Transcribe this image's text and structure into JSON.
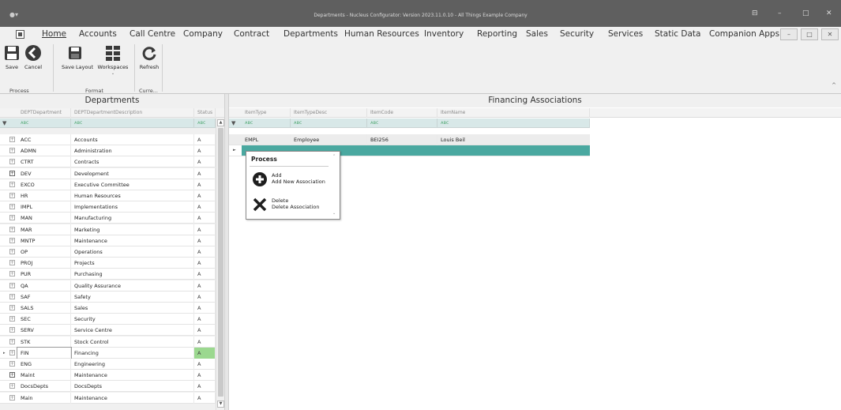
{
  "window": {
    "title": "Departments - Nucleus Configurator: Version 2023.11.0.10 - All Things Example Company",
    "app_icon": "app-icon",
    "controls": [
      "⊟",
      "–",
      "□",
      "✕"
    ]
  },
  "menu": {
    "items": [
      "Home",
      "Accounts",
      "Call Centre",
      "Company",
      "Contract",
      "Departments",
      "Human Resources",
      "Inventory",
      "Reporting",
      "Sales",
      "Security",
      "Services",
      "Static Data",
      "Companion Apps"
    ],
    "active": "Home",
    "mdi_controls": [
      "–",
      "□",
      "✕"
    ]
  },
  "ribbon": {
    "buttons": {
      "save": "Save",
      "cancel": "Cancel",
      "save_layout": "Save Layout",
      "workspaces": "Workspaces",
      "refresh": "Refresh"
    },
    "groups": {
      "process": "Process",
      "format": "Format",
      "current": "Curre..."
    },
    "collapse_glyph": "^"
  },
  "departments": {
    "title": "Departments",
    "columns": [
      "DEPTDepartment",
      "DEPTDepartmentDescription",
      "Status"
    ],
    "filter_glyph": "ᴀʙc",
    "rows": [
      {
        "code": "ACC",
        "desc": "Accounts",
        "status": "A"
      },
      {
        "code": "ADMN",
        "desc": "Administration",
        "status": "A"
      },
      {
        "code": "CTRT",
        "desc": "Contracts",
        "status": "A"
      },
      {
        "code": "DEV",
        "desc": "Development",
        "status": "A"
      },
      {
        "code": "EXCO",
        "desc": "Executive Committee",
        "status": "A"
      },
      {
        "code": "HR",
        "desc": "Human Resources",
        "status": "A"
      },
      {
        "code": "IMPL",
        "desc": "Implementations",
        "status": "A"
      },
      {
        "code": "MAN",
        "desc": "Manufacturing",
        "status": "A"
      },
      {
        "code": "MAR",
        "desc": "Marketing",
        "status": "A"
      },
      {
        "code": "MNTP",
        "desc": "Maintenance",
        "status": "A"
      },
      {
        "code": "OP",
        "desc": "Operations",
        "status": "A"
      },
      {
        "code": "PROJ",
        "desc": "Projects",
        "status": "A"
      },
      {
        "code": "PUR",
        "desc": "Purchasing",
        "status": "A"
      },
      {
        "code": "QA",
        "desc": "Quality Assurance",
        "status": "A"
      },
      {
        "code": "SAF",
        "desc": "Safety",
        "status": "A"
      },
      {
        "code": "SALS",
        "desc": "Sales",
        "status": "A"
      },
      {
        "code": "SEC",
        "desc": "Security",
        "status": "A"
      },
      {
        "code": "SERV",
        "desc": "Service Centre",
        "status": "A"
      },
      {
        "code": "STK",
        "desc": "Stock Control",
        "status": "A"
      },
      {
        "code": "FIN",
        "desc": "Financing",
        "status": "A"
      },
      {
        "code": "ENG",
        "desc": "Engineering",
        "status": "A"
      },
      {
        "code": "Maint",
        "desc": "Maintenance",
        "status": "A"
      },
      {
        "code": "DocsDepts",
        "desc": "DocsDepts",
        "status": "A"
      },
      {
        "code": "Main",
        "desc": "Maintenance",
        "status": "A"
      }
    ],
    "selected_code": "FIN"
  },
  "associations": {
    "title": "Financing Associations",
    "columns": [
      "ItemType",
      "ItemTypeDesc",
      "ItemCode",
      "ItemName"
    ],
    "rows": [
      {
        "type": "EMPL",
        "desc": "Employee",
        "code": "BEI256",
        "name": "Louis Beil"
      }
    ]
  },
  "popup": {
    "title": "Process",
    "items": [
      {
        "icon": "add-circle-icon",
        "label": "Add",
        "desc": "Add New Association"
      },
      {
        "icon": "delete-x-icon",
        "label": "Delete",
        "desc": "Delete Association"
      }
    ]
  },
  "colors": {
    "titlebar": "#5f5f5f",
    "filter_row": "#d8e8e8",
    "status_highlight": "#9bd88f",
    "new_row": "#4aa8a0"
  }
}
